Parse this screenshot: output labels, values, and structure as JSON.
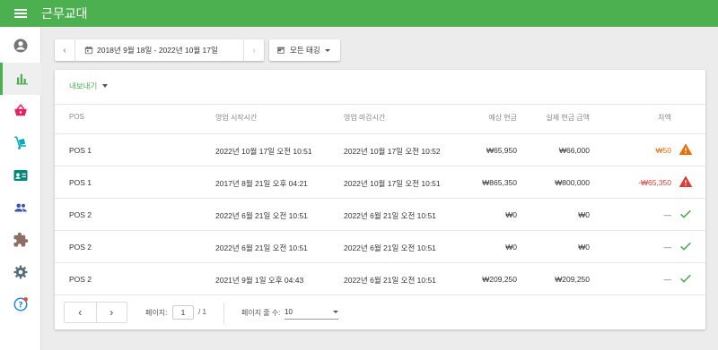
{
  "app": {
    "title": "근무교대"
  },
  "colors": {
    "brand": "#4caf50",
    "warning": "#ef6c00",
    "error": "#e53935",
    "success": "#4caf50"
  },
  "sidebar": {
    "items": [
      {
        "icon": "account-circle-icon"
      },
      {
        "icon": "bar-chart-icon",
        "active": true
      },
      {
        "icon": "basket-icon"
      },
      {
        "icon": "dolly-icon"
      },
      {
        "icon": "id-card-icon"
      },
      {
        "icon": "people-icon"
      },
      {
        "icon": "puzzle-icon"
      },
      {
        "icon": "gear-icon"
      },
      {
        "icon": "help-icon"
      }
    ]
  },
  "toolbar": {
    "prev_label": "‹",
    "next_label": "›",
    "date_range": "2018년 9월 18일 - 2022년 10월 17일",
    "tag_filter": "모든 태깅"
  },
  "card": {
    "export_label": "내보내기",
    "columns": [
      "POS",
      "영업 시작시간",
      "영업 마감시간",
      "예상 현금",
      "실제 현금 금액",
      "차액"
    ],
    "rows": [
      {
        "pos": "POS 1",
        "start": "2022년 10월 17일 오전 10:51",
        "end": "2022년 10월 17일 오전 10:52",
        "expected": "₩65,950",
        "actual": "₩66,000",
        "diff": "₩50",
        "status": "warning"
      },
      {
        "pos": "POS 1",
        "start": "2017년 8월 21일 오후 04:21",
        "end": "2022년 10월 17일 오전 10:51",
        "expected": "₩865,350",
        "actual": "₩800,000",
        "diff": "-₩65,350",
        "status": "error"
      },
      {
        "pos": "POS 2",
        "start": "2022년 6월 21일 오전 10:51",
        "end": "2022년 6월 21일 오전 10:51",
        "expected": "₩0",
        "actual": "₩0",
        "diff": "—",
        "status": "ok"
      },
      {
        "pos": "POS 2",
        "start": "2022년 6월 21일 오전 10:51",
        "end": "2022년 6월 21일 오전 10:51",
        "expected": "₩0",
        "actual": "₩0",
        "diff": "—",
        "status": "ok"
      },
      {
        "pos": "POS 2",
        "start": "2021년 9월 1일 오후 04:43",
        "end": "2022년 6월 21일 오전 10:51",
        "expected": "₩209,250",
        "actual": "₩209,250",
        "diff": "—",
        "status": "ok"
      }
    ]
  },
  "pagination": {
    "prev_label": "‹",
    "next_label": "›",
    "page_label": "페이지:",
    "page_value": "1",
    "page_total": "/ 1",
    "rows_label": "페이지 줄 수:",
    "rows_value": "10"
  }
}
